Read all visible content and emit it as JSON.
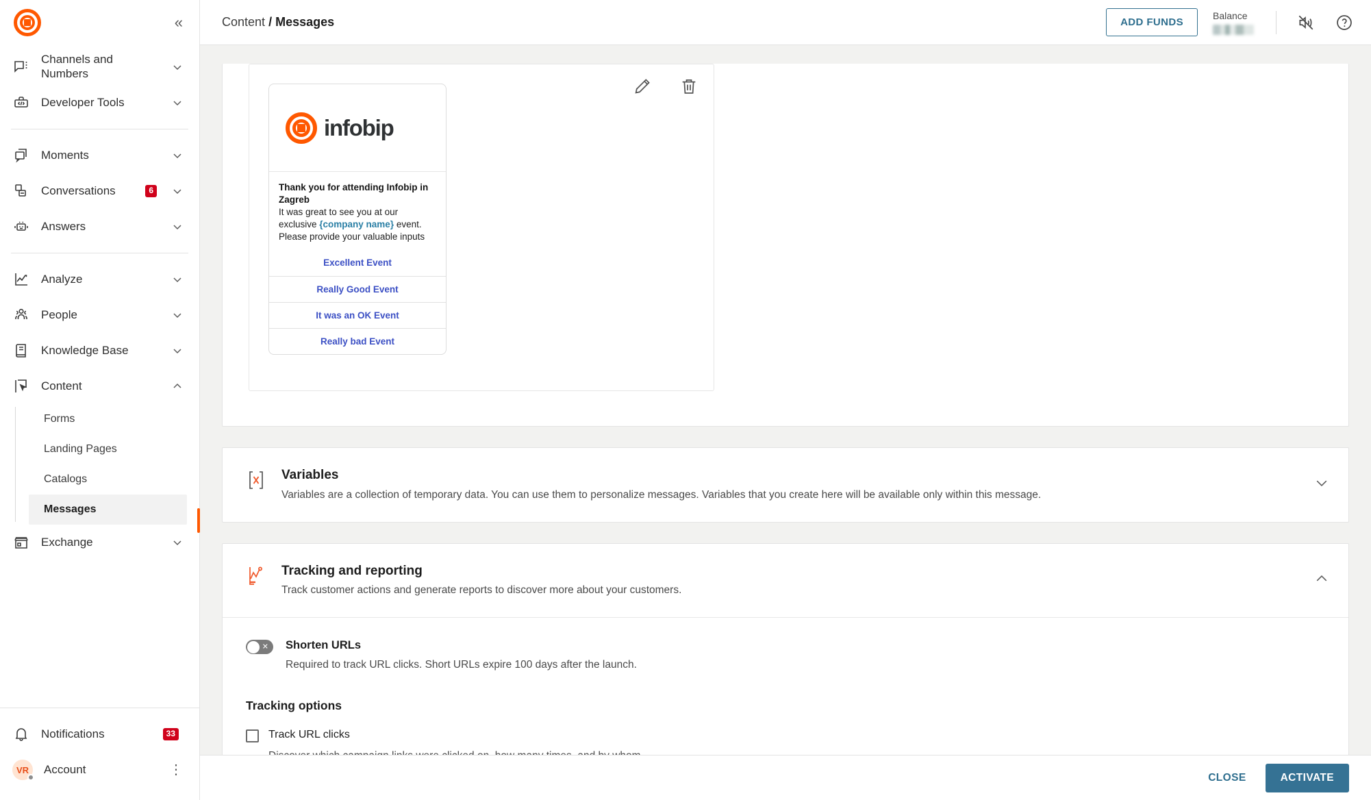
{
  "sidebar": {
    "logo": "infobip-logo",
    "collapse_label": "«",
    "groups": [
      {
        "items": [
          {
            "label": "Channels and Numbers",
            "icon": "chat-dots-icon",
            "chevron": "down"
          },
          {
            "label": "Developer Tools",
            "icon": "code-toolbox-icon",
            "chevron": "down"
          }
        ]
      },
      {
        "items": [
          {
            "label": "Moments",
            "icon": "layers-chat-icon",
            "chevron": "down"
          },
          {
            "label": "Conversations",
            "icon": "conversations-icon",
            "chevron": "down",
            "badge": "6"
          },
          {
            "label": "Answers",
            "icon": "robot-icon",
            "chevron": "down"
          }
        ]
      },
      {
        "items": [
          {
            "label": "Analyze",
            "icon": "line-chart-icon",
            "chevron": "down"
          },
          {
            "label": "People",
            "icon": "people-icon",
            "chevron": "down"
          },
          {
            "label": "Knowledge Base",
            "icon": "book-icon",
            "chevron": "down"
          },
          {
            "label": "Content",
            "icon": "content-cursor-icon",
            "chevron": "up",
            "expanded": true
          },
          {
            "label": "Exchange",
            "icon": "store-icon",
            "chevron": "down"
          }
        ]
      }
    ],
    "content_subitems": [
      {
        "label": "Forms",
        "selected": false
      },
      {
        "label": "Landing Pages",
        "selected": false
      },
      {
        "label": "Catalogs",
        "selected": false
      },
      {
        "label": "Messages",
        "selected": true
      }
    ],
    "bottom": {
      "notifications_label": "Notifications",
      "notifications_badge": "33",
      "notifications_icon": "bell-icon",
      "account_label": "Account",
      "account_initials": "VR",
      "account_menu_icon": "kebab-menu-icon"
    }
  },
  "header": {
    "breadcrumb_parent": "Content",
    "breadcrumb_separator": "/",
    "breadcrumb_current": "Messages",
    "add_funds_label": "ADD FUNDS",
    "balance_label": "Balance",
    "balance_value": "",
    "mute_icon": "speaker-mute-icon",
    "help_icon": "help-circle-icon"
  },
  "preview": {
    "edit_icon": "pencil-edit-icon",
    "delete_icon": "trash-delete-icon",
    "brand_word": "infobip",
    "message_title": "Thank you for attending Infobip in Zagreb",
    "message_body_pre": "It was great to see you at our exclusive ",
    "message_variable": "{company name}",
    "message_body_post": " event. Please provide your valuable inputs",
    "buttons": [
      {
        "label": "Excellent Event"
      },
      {
        "label": "Really Good Event"
      },
      {
        "label": "It was an OK Event"
      },
      {
        "label": "Really bad Event"
      }
    ]
  },
  "variables_section": {
    "icon": "variable-brackets-icon",
    "title": "Variables",
    "description": "Variables are a collection of temporary data. You can use them to personalize messages. Variables that you create here will be available only within this message.",
    "chevron": "down"
  },
  "tracking_section": {
    "icon": "tracking-chart-icon",
    "title": "Tracking and reporting",
    "description": "Track customer actions and generate reports to discover more about your customers.",
    "chevron": "up",
    "shorten_urls": {
      "label": "Shorten URLs",
      "description": "Required to track URL clicks. Short URLs expire 100 days after the launch.",
      "state": "off"
    },
    "options_title": "Tracking options",
    "track_url_clicks": {
      "label": "Track URL clicks",
      "description": "Discover which campaign links were clicked on, how many times, and by whom.",
      "checked": false
    }
  },
  "footer": {
    "close_label": "CLOSE",
    "activate_label": "ACTIVATE"
  },
  "colors": {
    "brand_orange": "#ff5800",
    "accent_teal": "#357294",
    "badge_red": "#d0021b",
    "link_blue": "#3b4fc4",
    "variable_blue": "#2a7fa5",
    "page_bg": "#f2f2f0"
  }
}
